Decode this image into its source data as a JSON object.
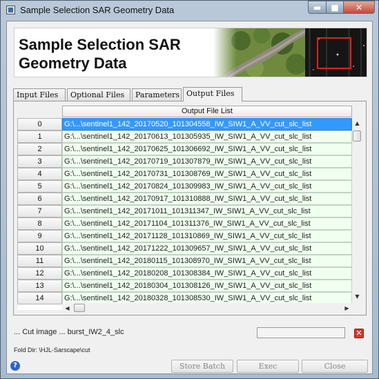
{
  "window": {
    "title": "Sample Selection SAR Geometry Data",
    "controls": {
      "minimize": "▬",
      "maximize": "■",
      "close": "✕"
    }
  },
  "banner": {
    "title": "Sample Selection SAR\nGeometry Data"
  },
  "tabs": [
    {
      "label": "Input Files",
      "active": false
    },
    {
      "label": "Optional Files",
      "active": false
    },
    {
      "label": "Parameters",
      "active": false
    },
    {
      "label": "Output Files",
      "active": true
    }
  ],
  "table": {
    "header": "Output File List",
    "selected_index": 0,
    "rows": [
      {
        "index": "0",
        "value": "G:\\...\\sentinel1_142_20170520_101304558_IW_SIW1_A_VV_cut_slc_list"
      },
      {
        "index": "1",
        "value": "G:\\...\\sentinel1_142_20170613_101305935_IW_SIW1_A_VV_cut_slc_list"
      },
      {
        "index": "2",
        "value": "G:\\...\\sentinel1_142_20170625_101306692_IW_SIW1_A_VV_cut_slc_list"
      },
      {
        "index": "3",
        "value": "G:\\...\\sentinel1_142_20170719_101307879_IW_SIW1_A_VV_cut_slc_list"
      },
      {
        "index": "4",
        "value": "G:\\...\\sentinel1_142_20170731_101308769_IW_SIW1_A_VV_cut_slc_list"
      },
      {
        "index": "5",
        "value": "G:\\...\\sentinel1_142_20170824_101309983_IW_SIW1_A_VV_cut_slc_list"
      },
      {
        "index": "6",
        "value": "G:\\...\\sentinel1_142_20170917_101310888_IW_SIW1_A_VV_cut_slc_list"
      },
      {
        "index": "7",
        "value": "G:\\...\\sentinel1_142_20171011_101311347_IW_SIW1_A_VV_cut_slc_list"
      },
      {
        "index": "8",
        "value": "G:\\...\\sentinel1_142_20171104_101311376_IW_SIW1_A_VV_cut_slc_list"
      },
      {
        "index": "9",
        "value": "G:\\...\\sentinel1_142_20171128_101310869_IW_SIW1_A_VV_cut_slc_list"
      },
      {
        "index": "10",
        "value": "G:\\...\\sentinel1_142_20171222_101309657_IW_SIW1_A_VV_cut_slc_list"
      },
      {
        "index": "11",
        "value": "G:\\...\\sentinel1_142_20180115_101308970_IW_SIW1_A_VV_cut_slc_list"
      },
      {
        "index": "12",
        "value": "G:\\...\\sentinel1_142_20180208_101308384_IW_SIW1_A_VV_cut_slc_list"
      },
      {
        "index": "13",
        "value": "G:\\...\\sentinel1_142_20180304_101308126_IW_SIW1_A_VV_cut_slc_list"
      },
      {
        "index": "14",
        "value": "G:\\...\\sentinel1_142_20180328_101308530_IW_SIW1_A_VV_cut_slc_list"
      }
    ]
  },
  "scroll": {
    "up": "▲",
    "down": "▼",
    "left": "◀",
    "right": "▶"
  },
  "status": {
    "message": "... Cut image ... burst_IW2_4_slc",
    "progress": 0,
    "fold_dir": "Fold Dir: \\HJL-Sarscape\\cut"
  },
  "cancel_icon": "✕",
  "help_icon": "?",
  "buttons": {
    "store_batch": "Store Batch",
    "exec": "Exec",
    "close": "Close"
  },
  "colors": {
    "selection": "#3399ff",
    "row_background": "#f0fff0",
    "cancel": "#d23a30",
    "help": "#2f64c8"
  }
}
